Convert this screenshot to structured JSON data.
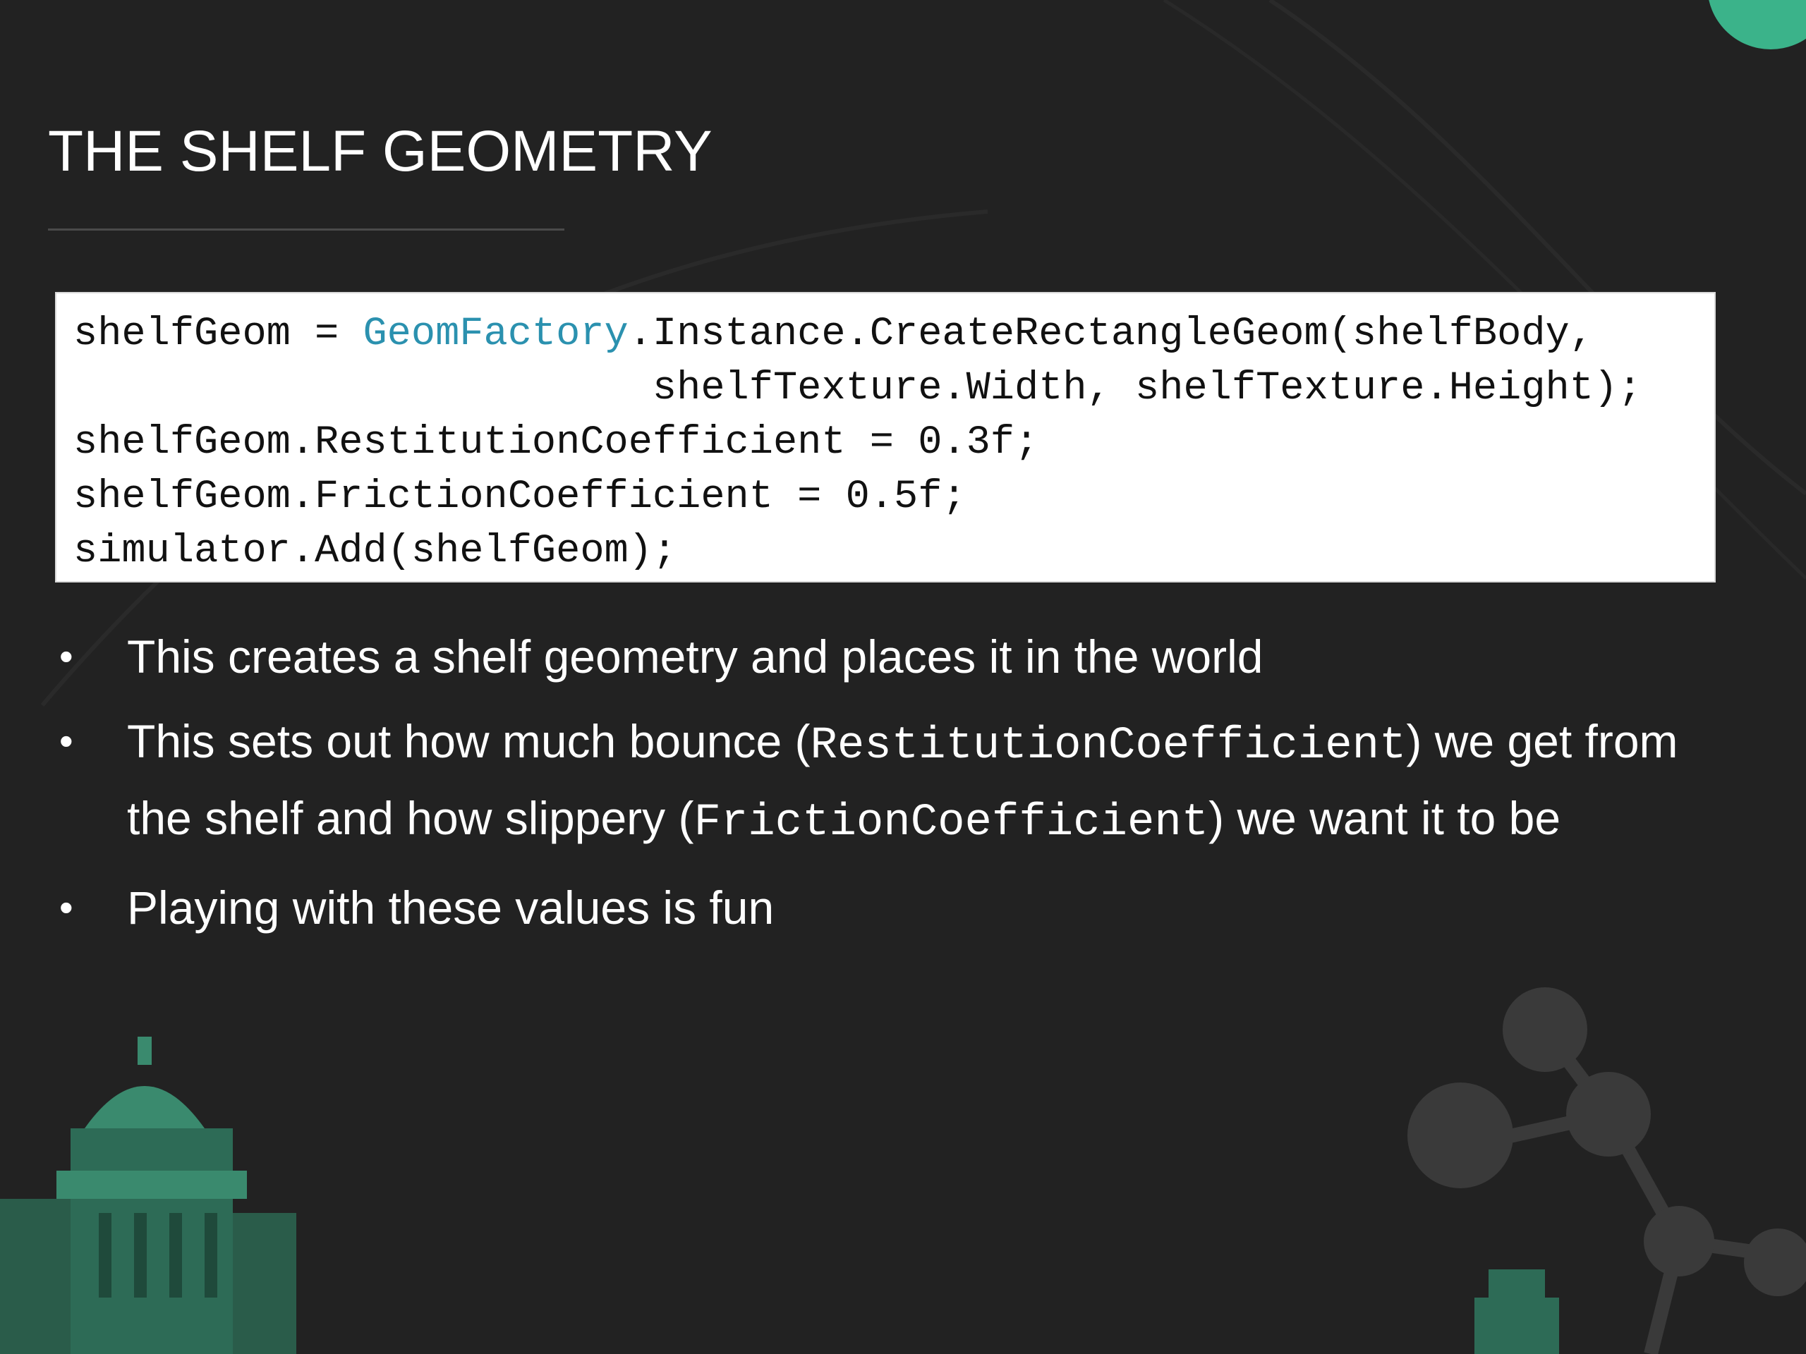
{
  "slide": {
    "title": "THE SHELF GEOMETRY",
    "code": {
      "line1_prefix": "shelfGeom = ",
      "line1_type": "GeomFactory",
      "line1_suffix": ".Instance.CreateRectangleGeom(shelfBody,",
      "line2": "                        shelfTexture.Width, shelfTexture.Height);",
      "line3": "shelfGeom.RestitutionCoefficient = 0.3f;",
      "line4": "shelfGeom.FrictionCoefficient = 0.5f;",
      "line5": "simulator.Add(shelfGeom);"
    },
    "bullets": {
      "marker": "•",
      "b1": "This creates a shelf geometry  and places it in the world",
      "b2_a": "This sets out how much bounce (",
      "b2_code1": "RestitutionCoefficient",
      "b2_b": ") we get from the shelf and how slippery (",
      "b2_code2": "FrictionCoefficient",
      "b2_c": ") we want it to be",
      "b3": "Playing with these values is fun"
    }
  },
  "colors": {
    "background": "#222222",
    "accent": "#3bb38a",
    "code_type": "#2b91af"
  }
}
